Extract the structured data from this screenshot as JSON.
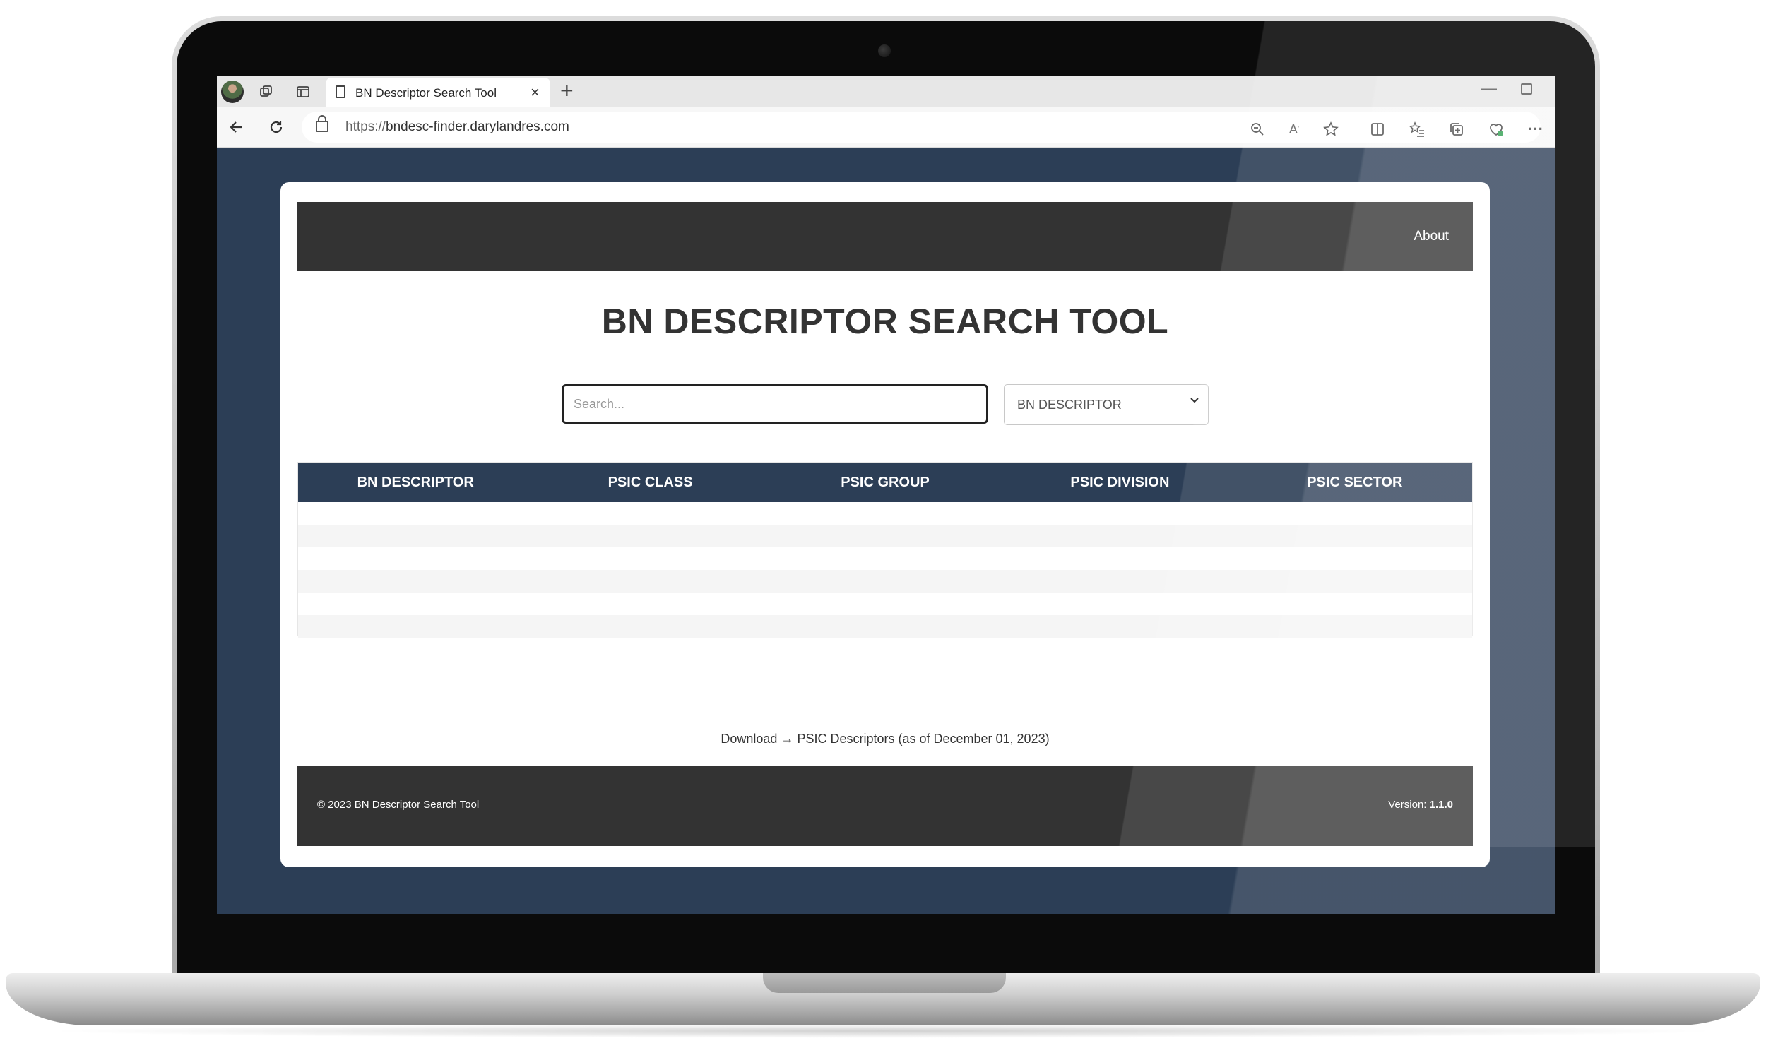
{
  "browser": {
    "tab_title": "BN Descriptor Search Tool",
    "new_tab": "+",
    "close_tab": "×",
    "url_scheme": "https://",
    "url_host": "bndesc-finder.darylandres.com"
  },
  "page": {
    "nav_about": "About",
    "title": "BN DESCRIPTOR SEARCH TOOL",
    "search_placeholder": "Search...",
    "filter_selected": "BN DESCRIPTOR",
    "table_headers": [
      "BN DESCRIPTOR",
      "PSIC CLASS",
      "PSIC GROUP",
      "PSIC DIVISION",
      "PSIC SECTOR"
    ],
    "download_text": "Download → PSIC Descriptors (as of December 01, 2023)",
    "footer_copyright": "© 2023 BN Descriptor Search Tool",
    "footer_version_label": "Version: ",
    "footer_version_value": "1.1.0"
  },
  "colors": {
    "screen_background": "#2c3e56",
    "navbar": "#333333",
    "table_header": "#2c3e56",
    "footer": "#333333"
  }
}
